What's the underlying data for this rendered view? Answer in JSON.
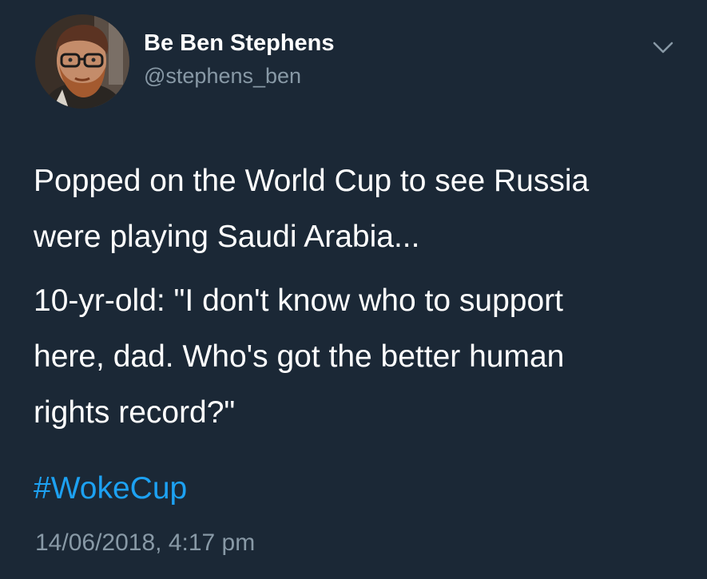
{
  "author": {
    "display_name": "Be Ben Stephens",
    "handle": "@stephens_ben",
    "avatar_icon": "profile-photo-avatar"
  },
  "tweet": {
    "lines": [
      "Popped on the World Cup to see Russia",
      "were playing Saudi Arabia...",
      "10-yr-old: \"I don't know who to support",
      "here, dad. Who's got the better human",
      "rights record?\""
    ],
    "hashtag": "#WokeCup",
    "timestamp": "14/06/2018, 4:17 pm"
  },
  "menu": {
    "icon": "chevron-down-icon"
  },
  "colors": {
    "background": "#1b2836",
    "text_primary": "#ffffff",
    "text_secondary": "#8899a6",
    "link": "#1da1f2"
  }
}
